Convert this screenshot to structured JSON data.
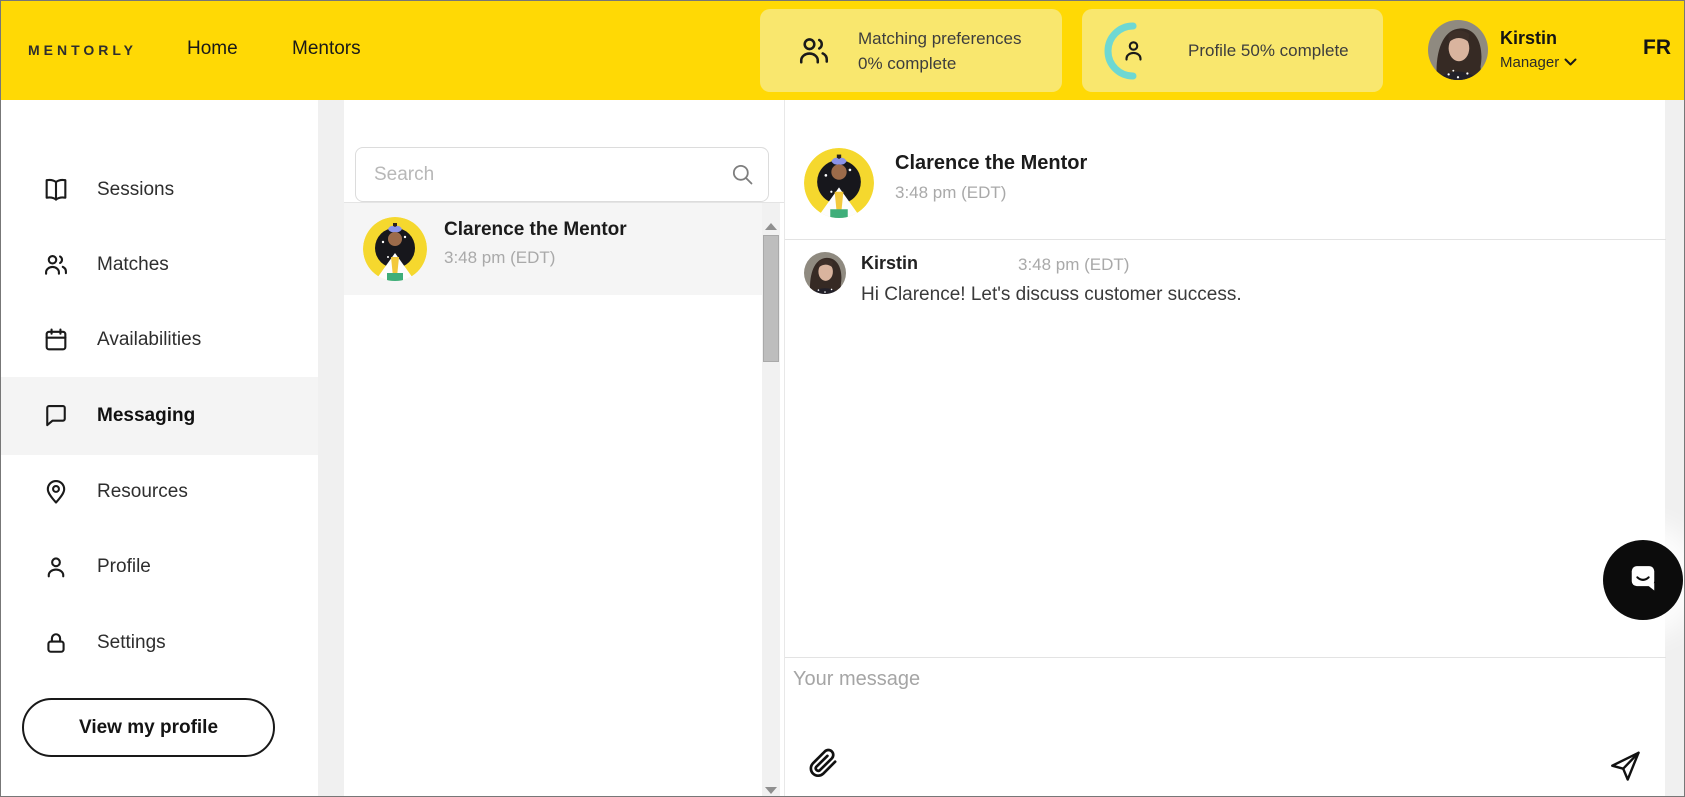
{
  "header": {
    "logo": "MENTORLY",
    "nav": [
      {
        "label": "Home"
      },
      {
        "label": "Mentors"
      }
    ],
    "matching_badge": {
      "line1": "Matching preferences",
      "line2": "0% complete"
    },
    "profile_badge": {
      "label": "Profile 50% complete",
      "progress_percent": 50
    },
    "user": {
      "name": "Kirstin",
      "role": "Manager"
    },
    "language": "FR"
  },
  "sidebar": {
    "items": [
      {
        "label": "Sessions",
        "icon": "book-icon",
        "active": false
      },
      {
        "label": "Matches",
        "icon": "users-icon",
        "active": false
      },
      {
        "label": "Availabilities",
        "icon": "calendar-icon",
        "active": false
      },
      {
        "label": "Messaging",
        "icon": "chat-icon",
        "active": true
      },
      {
        "label": "Resources",
        "icon": "pin-icon",
        "active": false
      },
      {
        "label": "Profile",
        "icon": "person-icon",
        "active": false
      },
      {
        "label": "Settings",
        "icon": "lock-icon",
        "active": false
      }
    ],
    "view_profile_button": "View my profile"
  },
  "conversations": {
    "search_placeholder": "Search",
    "items": [
      {
        "name": "Clarence the Mentor",
        "time": "3:48 pm (EDT)",
        "selected": true
      }
    ]
  },
  "chat": {
    "header": {
      "name": "Clarence the Mentor",
      "time": "3:48 pm (EDT)"
    },
    "messages": [
      {
        "sender": "Kirstin",
        "time": "3:48 pm (EDT)",
        "text": "Hi Clarence! Let's discuss customer success."
      }
    ],
    "input_placeholder": "Your message"
  },
  "colors": {
    "header_bg": "#FFD905",
    "badge_bg": "#F9E76E",
    "progress_teal": "#6ED8D2",
    "active_row": "#F4F4F4"
  }
}
